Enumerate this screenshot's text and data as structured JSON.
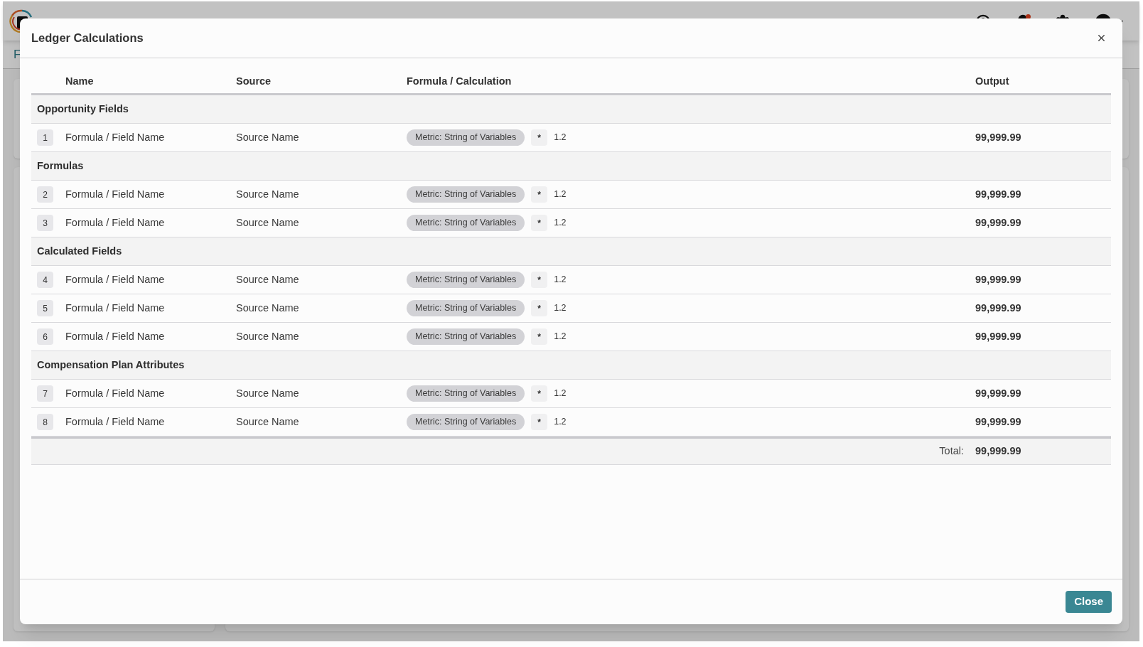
{
  "background": {
    "page_title_fragment": "F"
  },
  "dialog": {
    "title": "Ledger Calculations",
    "table": {
      "columns": [
        "Name",
        "Source",
        "Formula / Calculation",
        "Output"
      ],
      "groups": [
        {
          "title": "Opportunity Fields",
          "rows": [
            {
              "index": "1",
              "name": "Formula / Field Name",
              "source": "Source Name",
              "metric": "Metric: String of Variables",
              "operator": "*",
              "factor": "1.2",
              "output": "99,999.99"
            }
          ]
        },
        {
          "title": "Formulas",
          "rows": [
            {
              "index": "2",
              "name": "Formula / Field Name",
              "source": "Source Name",
              "metric": "Metric: String of Variables",
              "operator": "*",
              "factor": "1.2",
              "output": "99,999.99"
            },
            {
              "index": "3",
              "name": "Formula / Field Name",
              "source": "Source Name",
              "metric": "Metric: String of Variables",
              "operator": "*",
              "factor": "1.2",
              "output": "99,999.99"
            }
          ]
        },
        {
          "title": "Calculated Fields",
          "rows": [
            {
              "index": "4",
              "name": "Formula / Field Name",
              "source": "Source Name",
              "metric": "Metric: String of Variables",
              "operator": "*",
              "factor": "1.2",
              "output": "99,999.99"
            },
            {
              "index": "5",
              "name": "Formula / Field Name",
              "source": "Source Name",
              "metric": "Metric: String of Variables",
              "operator": "*",
              "factor": "1.2",
              "output": "99,999.99"
            },
            {
              "index": "6",
              "name": "Formula / Field Name",
              "source": "Source Name",
              "metric": "Metric: String of Variables",
              "operator": "*",
              "factor": "1.2",
              "output": "99,999.99"
            }
          ]
        },
        {
          "title": "Compensation Plan Attributes",
          "rows": [
            {
              "index": "7",
              "name": "Formula / Field Name",
              "source": "Source Name",
              "metric": "Metric: String of Variables",
              "operator": "*",
              "factor": "1.2",
              "output": "99,999.99"
            },
            {
              "index": "8",
              "name": "Formula / Field Name",
              "source": "Source Name",
              "metric": "Metric: String of Variables",
              "operator": "*",
              "factor": "1.2",
              "output": "99,999.99"
            }
          ]
        }
      ],
      "total": {
        "label": "Total:",
        "value": "99,999.99"
      }
    },
    "buttons": [
      "Close"
    ]
  }
}
